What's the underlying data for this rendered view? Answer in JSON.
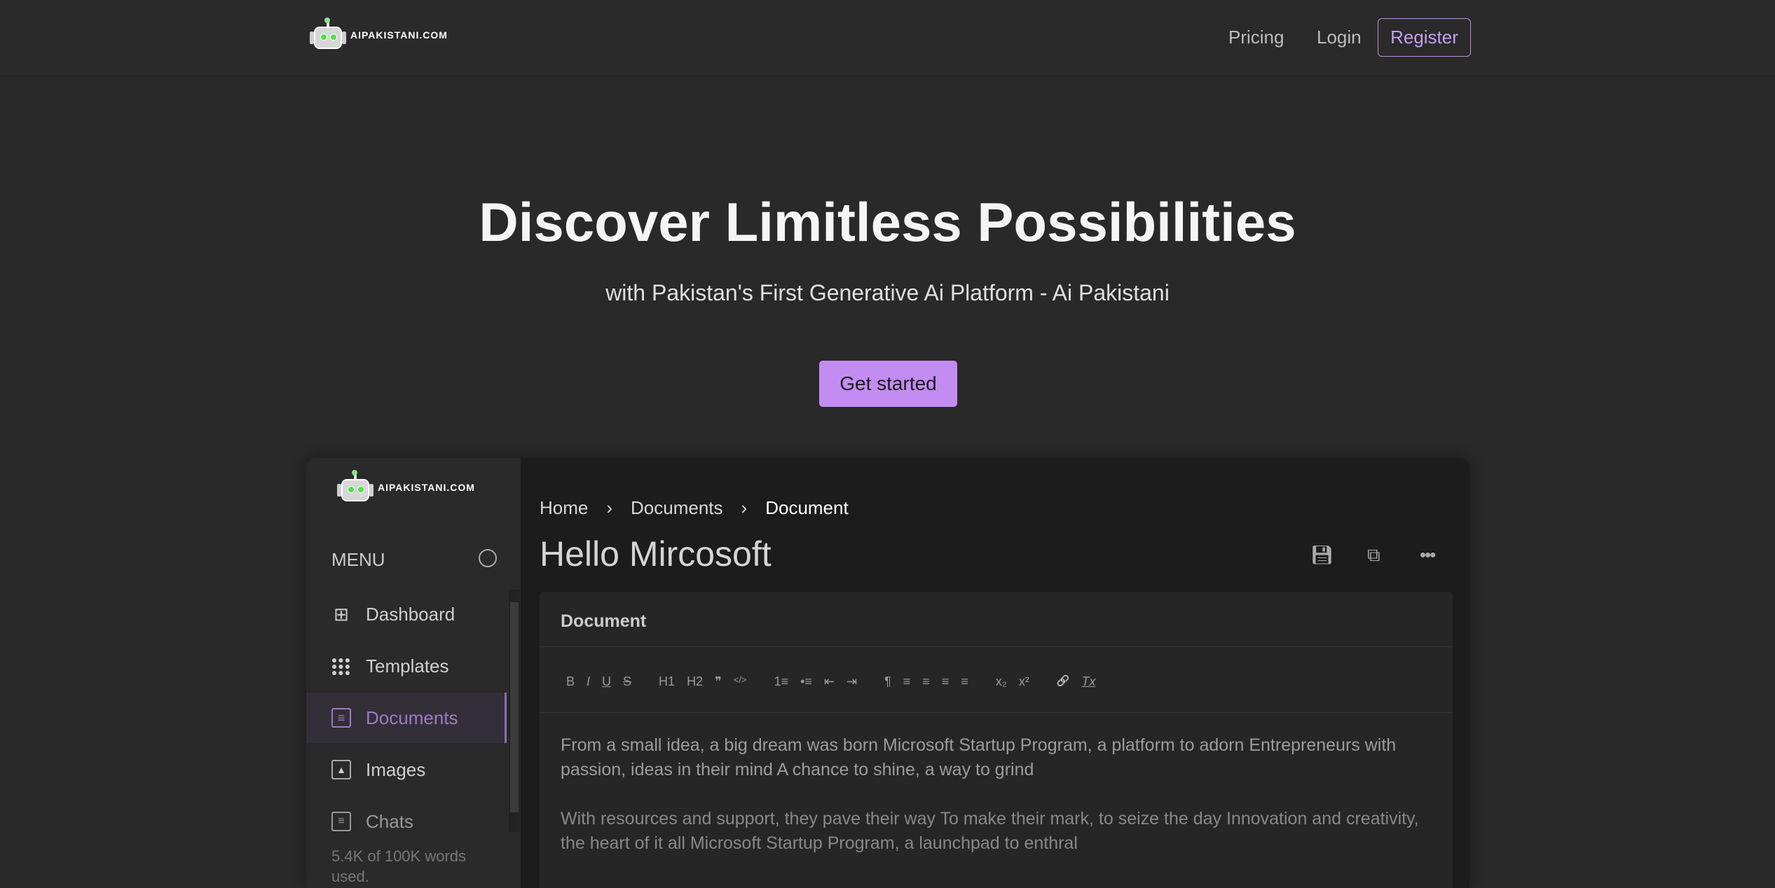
{
  "nav": {
    "brand": "AIPAKISTANI.COM",
    "links": [
      "Pricing",
      "Login"
    ],
    "register": "Register"
  },
  "hero": {
    "title": "Discover Limitless Possibilities",
    "subtitle": "with Pakistan's First Generative Ai Platform - Ai Pakistani",
    "cta": "Get started"
  },
  "app": {
    "brand": "AIPAKISTANI.COM",
    "menu_label": "MENU",
    "menu": [
      {
        "label": "Dashboard",
        "icon": "grid-icon"
      },
      {
        "label": "Templates",
        "icon": "dots-grid-icon"
      },
      {
        "label": "Documents",
        "icon": "document-icon",
        "active": true
      },
      {
        "label": "Images",
        "icon": "image-icon"
      },
      {
        "label": "Chats",
        "icon": "chat-icon"
      }
    ],
    "usage": "5.4K of 100K words used.",
    "breadcrumb": [
      "Home",
      "Documents",
      "Document"
    ],
    "title": "Hello Mircosoft",
    "card_title": "Document",
    "toolbar": [
      "B",
      "I",
      "U",
      "S",
      "H1",
      "H2",
      "❞",
      "</>",
      "1≡",
      "•≡",
      "⇤",
      "⇥",
      "¶",
      "≡",
      "≡",
      "≡",
      "≡",
      "x₂",
      "x²",
      "🔗",
      "Tx"
    ],
    "paragraphs": [
      "From a small idea, a big dream was born Microsoft Startup Program, a platform to adorn Entrepreneurs with passion, ideas in their mind A chance to shine, a way to grind",
      "With resources and support, they pave their way To make their mark, to seize the day Innovation and creativity, the heart of it all Microsoft Startup Program, a launchpad to enthral"
    ]
  },
  "colors": {
    "accent": "#c38cf2",
    "bg": "#292929"
  }
}
